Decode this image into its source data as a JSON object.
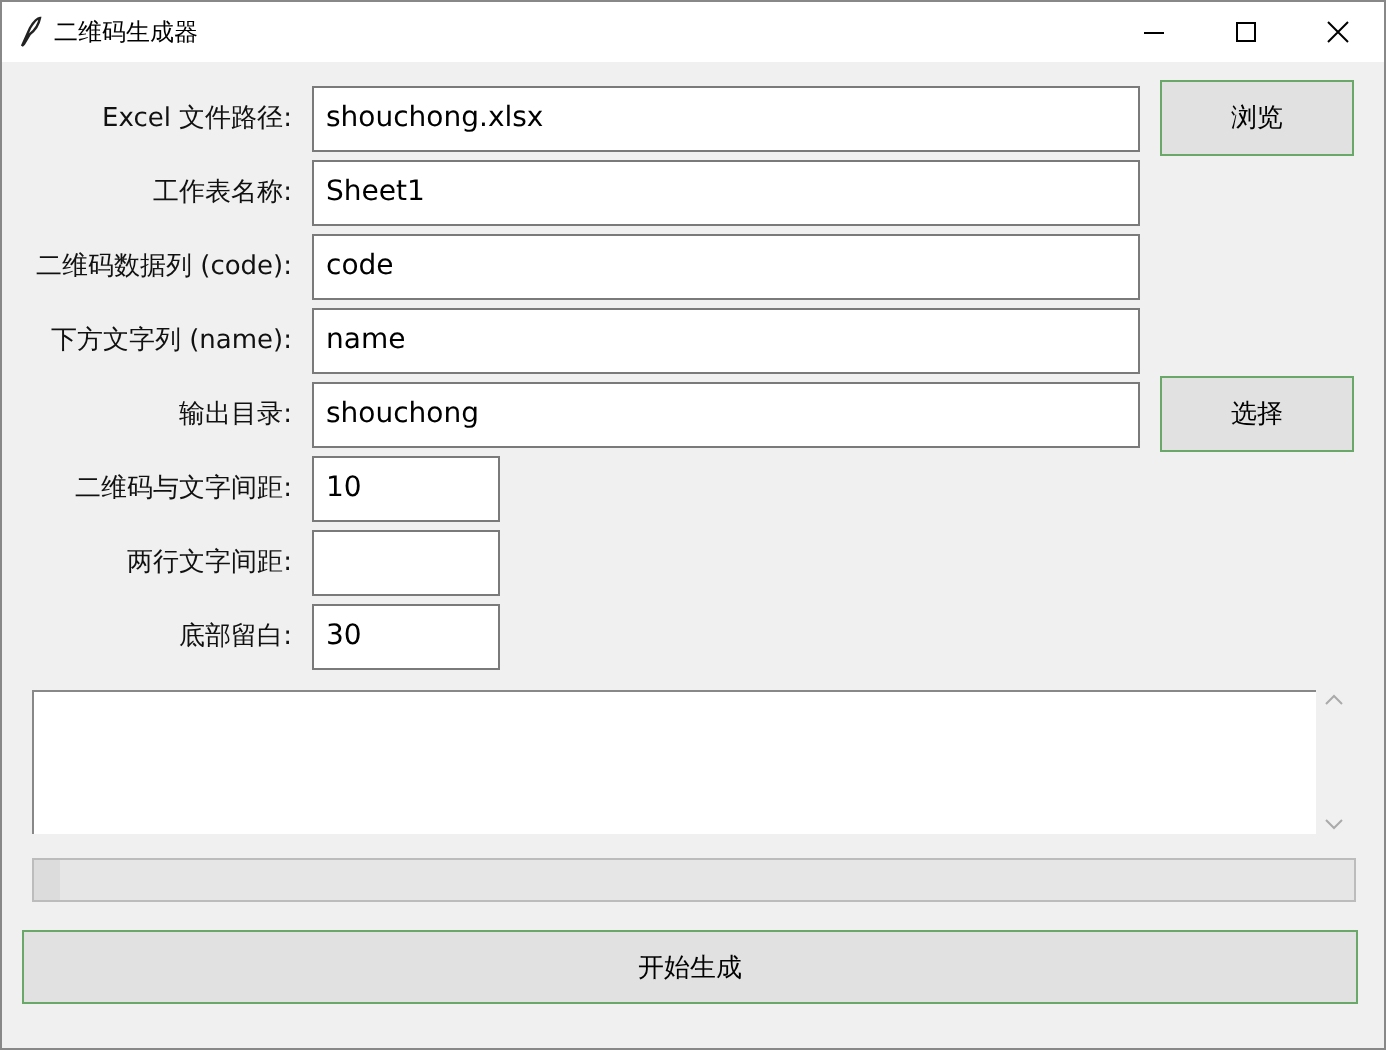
{
  "window": {
    "title": "二维码生成器"
  },
  "fields": [
    {
      "label": "Excel 文件路径:",
      "value": "shouchong.xlsx",
      "kind": "wide",
      "button": "浏览"
    },
    {
      "label": "工作表名称:",
      "value": "Sheet1",
      "kind": "wide"
    },
    {
      "label": "二维码数据列 (code):",
      "value": "code",
      "kind": "wide"
    },
    {
      "label": "下方文字列 (name):",
      "value": "name",
      "kind": "wide"
    },
    {
      "label": "输出目录:",
      "value": "shouchong",
      "kind": "wide",
      "button": "选择"
    },
    {
      "label": "二维码与文字间距:",
      "value": "10",
      "kind": "short"
    },
    {
      "label": "两行文字间距:",
      "kind": "short"
    },
    {
      "label": "底部留白:",
      "value": "30",
      "kind": "short"
    }
  ],
  "progress": {
    "level": 0.02
  },
  "start_button": "开始生成"
}
